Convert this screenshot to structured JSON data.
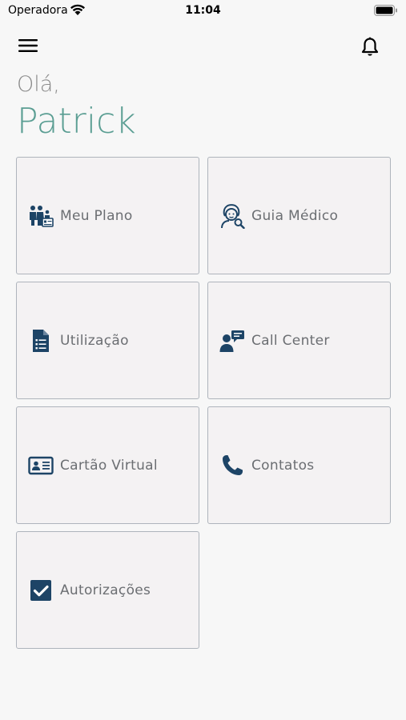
{
  "status_bar": {
    "carrier": "Operadora",
    "time": "11:04"
  },
  "header": {
    "menu_icon": "hamburger-icon",
    "notification_icon": "bell-icon"
  },
  "greeting": {
    "hello": "Olá,",
    "name": "Patrick"
  },
  "colors": {
    "accent": "#5b9e93",
    "icon": "#1d4466",
    "tile_bg": "#f4f2f3",
    "tile_border": "#aeb4bc"
  },
  "tiles": [
    {
      "label": "Meu Plano",
      "icon": "family-card-icon"
    },
    {
      "label": "Guia Médico",
      "icon": "doctor-search-icon"
    },
    {
      "label": "Utilização",
      "icon": "document-list-icon"
    },
    {
      "label": "Call Center",
      "icon": "support-agent-icon"
    },
    {
      "label": "Cartão Virtual",
      "icon": "id-card-icon"
    },
    {
      "label": "Contatos",
      "icon": "phone-icon"
    },
    {
      "label": "Autorizações",
      "icon": "checkbox-icon"
    }
  ]
}
